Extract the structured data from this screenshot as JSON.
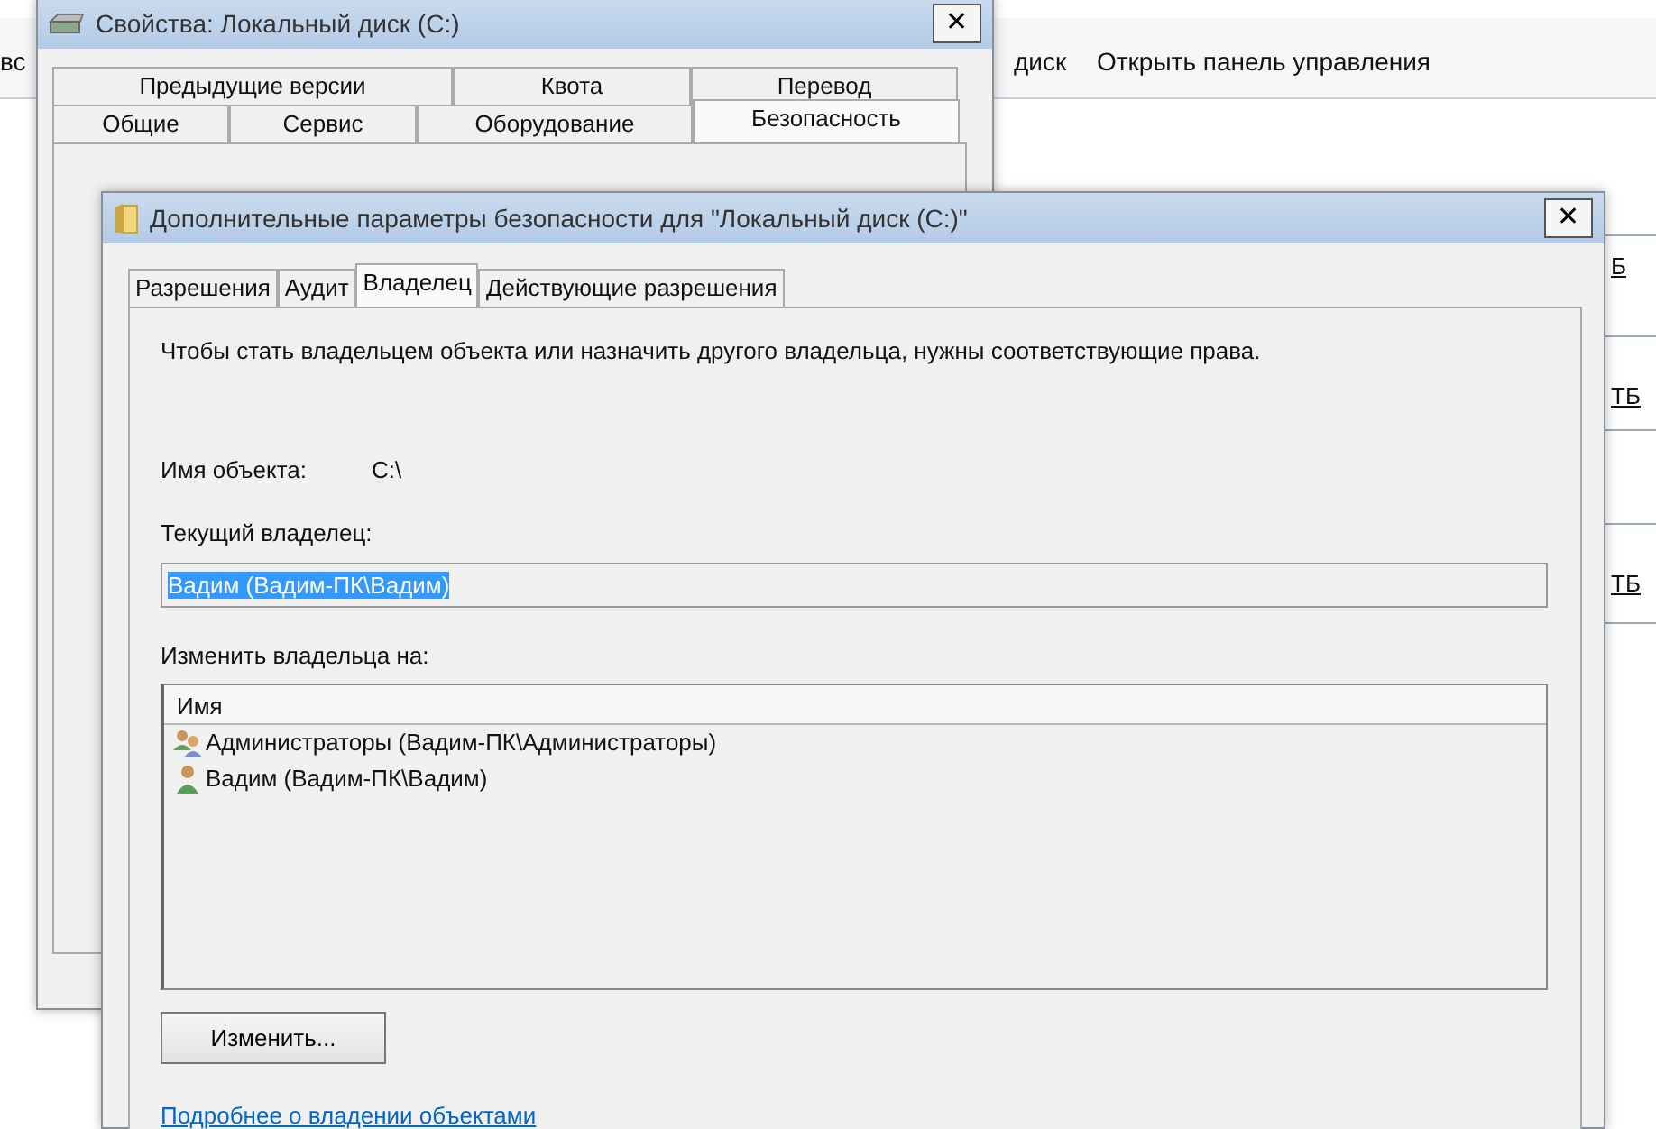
{
  "explorer": {
    "toolbar": [
      "вс",
      "диск",
      "Открыть панель управления"
    ],
    "sizes": [
      "Б",
      "ТБ",
      "ТБ"
    ]
  },
  "properties_dialog": {
    "title": "Свойства: Локальный диск (C:)",
    "close": "✕",
    "tab_rows": [
      [
        {
          "label": "Предыдущие версии",
          "selected": false
        },
        {
          "label": "Квота",
          "selected": false
        },
        {
          "label": "Перевод",
          "selected": false
        }
      ],
      [
        {
          "label": "Общие",
          "selected": false
        },
        {
          "label": "Сервис",
          "selected": false
        },
        {
          "label": "Оборудование",
          "selected": false
        },
        {
          "label": "Безопасность",
          "selected": true
        }
      ]
    ]
  },
  "security_dialog": {
    "title": "Дополнительные параметры безопасности  для \"Локальный диск (C:)\"",
    "close": "✕",
    "tabs": [
      {
        "label": "Разрешения",
        "selected": false
      },
      {
        "label": "Аудит",
        "selected": false
      },
      {
        "label": "Владелец",
        "selected": true
      },
      {
        "label": "Действующие разрешения",
        "selected": false
      }
    ],
    "intro": "Чтобы стать владельцем объекта или назначить другого владельца, нужны соответствующие права.",
    "object_name": {
      "label": "Имя объекта:",
      "value": "C:\\"
    },
    "current_owner": {
      "label": "Текущий владелец:",
      "value": "Вадим (Вадим-ПК\\Вадим)",
      "selected": true
    },
    "change_owner": {
      "label": "Изменить владельца на:",
      "column": "Имя",
      "rows": [
        {
          "kind": "group",
          "name": "Администраторы (Вадим-ПК\\Администраторы)"
        },
        {
          "kind": "user",
          "name": "Вадим (Вадим-ПК\\Вадим)"
        }
      ]
    },
    "button": "Изменить...",
    "link": "Подробнее о владении объектами"
  }
}
